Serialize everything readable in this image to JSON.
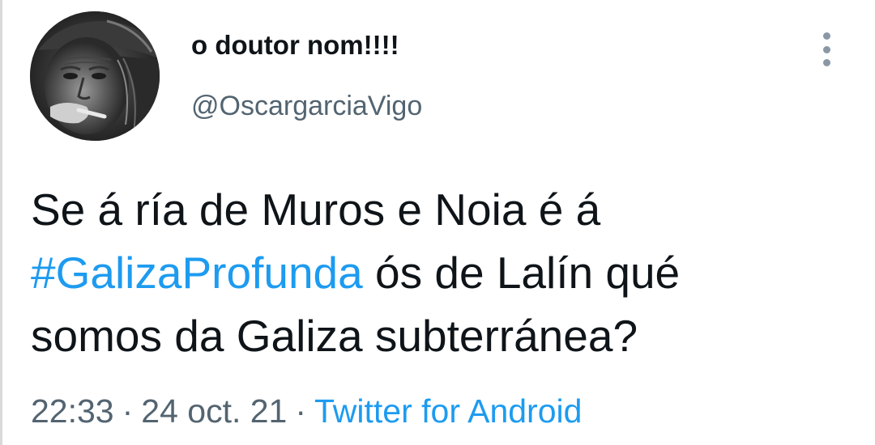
{
  "tweet": {
    "display_name": "o doutor nom!!!!",
    "handle": "@OscargarciaVigo",
    "text": {
      "line1": "Se á ría de Muros e Noia é á",
      "hashtag": "#GalizaProfunda",
      "line2_rest": " ós de Lalín qué",
      "line3": "somos da Galiza subterránea?"
    },
    "time": "22:33",
    "date": "24 oct. 21",
    "separator": "·",
    "source": "Twitter for Android"
  },
  "icons": {
    "more": "more-vertical-icon",
    "avatar": "avatar"
  },
  "colors": {
    "link": "#1d9bf0",
    "secondary_text": "#536471",
    "primary_text": "#0f1419",
    "more_dots": "#8a98a5"
  }
}
